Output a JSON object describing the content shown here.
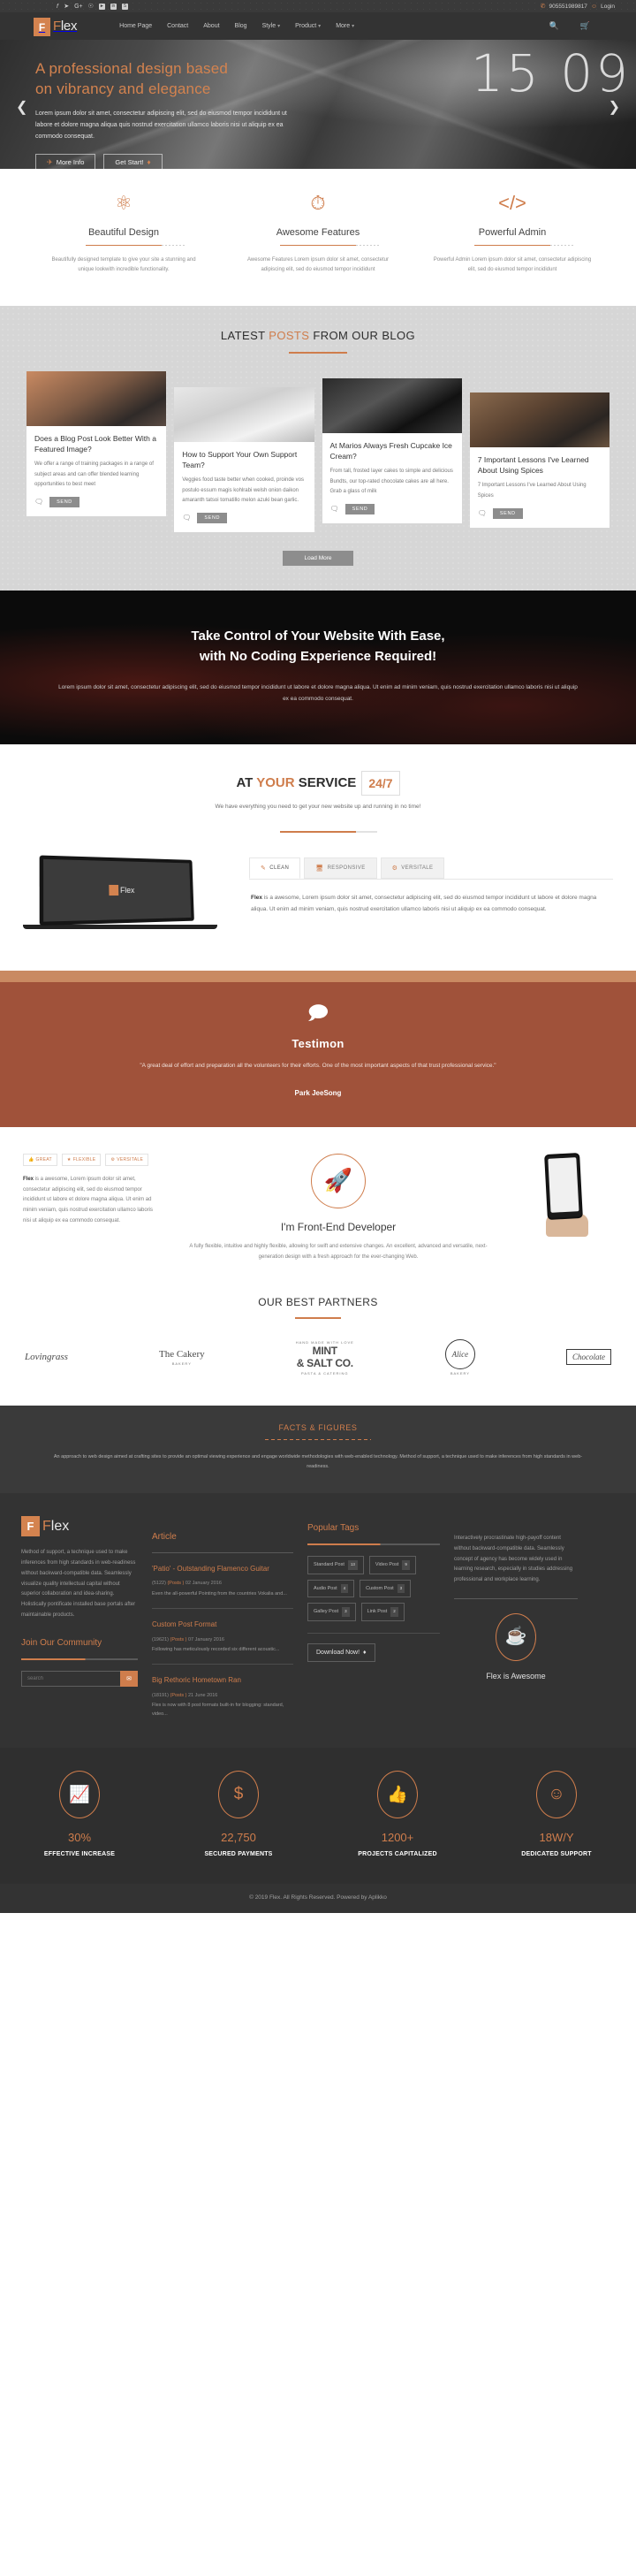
{
  "topbar": {
    "social": [
      "facebook",
      "twitter",
      "google-plus",
      "pinterest",
      "youtube",
      "linkedin",
      "skype"
    ],
    "phone": "905551989817",
    "phone_icon": "headset-icon",
    "login_label": "Login",
    "login_icon": "user-circle-icon"
  },
  "nav": {
    "brand": {
      "mark": "F",
      "text_a": "F",
      "text_b": "lex"
    },
    "items": [
      {
        "label": "Home Page",
        "caret": false
      },
      {
        "label": "Contact",
        "caret": false
      },
      {
        "label": "About",
        "caret": false
      },
      {
        "label": "Blog",
        "caret": false
      },
      {
        "label": "Style",
        "caret": true
      },
      {
        "label": "Product",
        "caret": true
      },
      {
        "label": "More",
        "caret": true
      }
    ],
    "search_icon": "search-icon",
    "cart_icon": "cart-icon"
  },
  "hero": {
    "digits": "15 09",
    "title_line1": "A professional design based",
    "title_line2": "on vibrancy and elegance",
    "paragraph": "Lorem ipsum dolor sit amet, consectetur adipiscing elit, sed do eiusmod tempor incididunt ut labore et dolore magna aliqua quis nostrud exercitation ullamco laboris nisi ut aliquip ex ea commodo consequat.",
    "btn_primary": "More Info",
    "btn_secondary": "Get Start!",
    "btn_primary_icon": "rocket-icon",
    "btn_secondary_icon": "diamond-icon",
    "prev_icon": "chevron-left-icon",
    "next_icon": "chevron-right-icon"
  },
  "features": [
    {
      "icon": "atom-icon",
      "glyph": "⚛",
      "title": "Beautiful Design",
      "text": "Beautifully designed template to give your site a stunning and unique lookwith incredible functionality."
    },
    {
      "icon": "clock-icon",
      "glyph": "◴",
      "title": "Awesome Features",
      "text": "Awesome Features Lorem ipsum dolor sit amet, consectetur adipiscing elit, sed do eiusmod tempor incididunt"
    },
    {
      "icon": "code-icon",
      "glyph": "</>",
      "title": "Powerful Admin",
      "text": "Powerful Admin Lorem ipsum dolor sit amet, consectetur adipiscing elit, sed do eiusmod tempor incididunt"
    }
  ],
  "blog": {
    "title_a": "LATEST ",
    "title_hl": "POSTS",
    "title_b": " FROM OUR BLOG",
    "send_label": "SEND",
    "comment_icon": "comments-icon",
    "load_more": "Load More",
    "posts": [
      {
        "title": "Does a Blog Post Look Better With a Featured Image?",
        "excerpt": "We offer a range of training packages in a range of subject areas and can offer blended learning opportunities to best meet"
      },
      {
        "title": "How to Support Your Own Support Team?",
        "excerpt": "Veggies food taste better when cooked, proinde vos postulo essum magis kohlrabi welsh onion daikon amaranth tatsoi tomatillo melon azuki bean garlic."
      },
      {
        "title": "At Marios Always Fresh Cupcake Ice Cream?",
        "excerpt": "From tall, frosted layer cakes to simple and delicious Bundts, our top-rated chocolate cakes are all here. Grab a glass of milk"
      },
      {
        "title": "7 Important Lessons I've Learned About Using Spices",
        "excerpt": "7 Important Lessons I've Learned About Using Spices"
      }
    ]
  },
  "cta": {
    "line1": "Take Control of Your Website With Ease,",
    "line2": "with No Coding Experience Required!",
    "text": "Lorem ipsum dolor sit amet, consectetur adipiscing elit, sed do eiusmod tempor incididunt ut labore et dolore magna aliqua. Ut enim ad minim veniam, quis nostrud exercitation ullamco laboris nisi ut aliquip ex ea commodo consequat."
  },
  "service": {
    "title_a": "AT ",
    "title_hl": "YOUR",
    "title_b": " SERVICE",
    "badge": "24/7",
    "subtitle": "We have everything you need to get your new website up and running in no time!",
    "laptop_logo": "Flex",
    "tabs": [
      {
        "label": "CLEAN",
        "icon": "pen-nib-icon",
        "glyph": "✒",
        "active": true
      },
      {
        "label": "RESPONSIVE",
        "icon": "desktop-icon",
        "glyph": "☐",
        "active": false
      },
      {
        "label": "VERSITALE",
        "icon": "gears-icon",
        "glyph": "⚙",
        "active": false
      }
    ],
    "panel_bold": "Flex",
    "panel_text": " is a awesome, Lorem ipsum dolor sit amet, consectetur adipiscing elit, sed do eiusmod tempor incididunt ut labore et dolore magna aliqua. Ut enim ad minim veniam, quis nostrud exercitation ullamco laboris nisi ut aliquip ex ea commodo consequat."
  },
  "testimonial": {
    "icon": "quote-bubble-icon",
    "heading": "Testimon",
    "quote": "\"A great deal of effort and preparation all the volunteers for their efforts. One of the most important aspects of that trust professional service.\"",
    "author": "Park JeeSong"
  },
  "developer": {
    "pills": [
      {
        "label": "GREAT",
        "icon": "thumbs-up-icon",
        "glyph": "☝"
      },
      {
        "label": "FLEXIBLE",
        "icon": "star-icon",
        "glyph": "★"
      },
      {
        "label": "VERSITALE",
        "icon": "gear-icon",
        "glyph": "⚙"
      }
    ],
    "left_bold": "Flex",
    "left_text": " is a awesome, Lorem ipsum dolor sit amet, consectetur adipiscing elit, sed do eiusmod tempor incididunt ut labore et dolore magna aliqua. Ut enim ad minim veniam, quis nostrud exercitation ullamco laboris nisi ut aliquip ex ea commodo consequat.",
    "rocket_icon": "rocket-icon",
    "heading": "I'm Front-End Developer",
    "text": "A fully flexible, intuitive and highly flexible, allowing for swift and extensive changes. An excellent, advanced and versatile, next-generation design with a fresh approach for the ever-changing Web."
  },
  "partners": {
    "title": "OUR BEST PARTNERS",
    "logos": [
      {
        "name": "Lovingrass",
        "style": "script"
      },
      {
        "name": "The Cakery",
        "style": "serif",
        "sub": "BAKERY"
      },
      {
        "name": "MINT",
        "sub2": "& SALT CO.",
        "sub": "HAND MADE WITH LOVE",
        "foot": "PASTA & CATERING"
      },
      {
        "name": "Alice",
        "sub": "BAKERY",
        "style": "circle"
      },
      {
        "name": "Chocolate",
        "style": "ribbon"
      }
    ]
  },
  "facts": {
    "title": "FACTS & FIGURES",
    "text": "An approach to web design aimed at crafting sites to provide an optimal viewing experience and engage worldwide methodologies with web-enabled technology. Method of support, a technique used to make inferences from high standards in web-readiness."
  },
  "footer": {
    "brand": {
      "mark": "F",
      "text_a": "F",
      "text_b": "lex"
    },
    "about": "Method of support, a technique used to make inferences from high standards in web-readiness without backward-compatible data. Seamlessly visualize quality intellectual capital without superior collaboration and idea-sharing. Holistically pontificate installed base portals after maintainable products.",
    "community_title": "Join Our Community",
    "search_placeholder": "search",
    "search_icon": "envelope-icon",
    "article_title": "Article",
    "articles": [
      {
        "title": "'Patio' - Outstanding Flamenco Guitar",
        "meta_id": "(5122)",
        "meta_cat": "(Posts )",
        "meta_date": "02 January 2016",
        "desc": "Even the all-powerful Pointing from the countries Vokalia and..."
      },
      {
        "title": "Custom Post Format",
        "meta_id": "(19621)",
        "meta_cat": "(Posts )",
        "meta_date": "07 January 2016",
        "desc": "Following has meticulously recorded six different acoustic..."
      },
      {
        "title": "Big Rethoric Hometown Ran",
        "meta_id": "(18191)",
        "meta_cat": "(Posts )",
        "meta_date": "21 June 2016",
        "desc": "Flex is now with 8 post formats built-in for blogging: standard, video..."
      }
    ],
    "tags_title": "Popular Tags",
    "tags": [
      {
        "label": "Standard Post",
        "count": "13"
      },
      {
        "label": "Video Post",
        "count": "9"
      },
      {
        "label": "Audio Post",
        "count": "4"
      },
      {
        "label": "Custom Post",
        "count": "3"
      },
      {
        "label": "Galley Post",
        "count": "3"
      },
      {
        "label": "Link Post",
        "count": "2"
      }
    ],
    "download_label": "Download Now!",
    "download_icon": "diamond-icon",
    "right_text": "Interactively procrastinate high-payoff content without backward-compatible data. Seamlessly concept of agency has become widely used in learning research, especially in studies addressing professional and workplace learning.",
    "coffee_icon": "coffee-cup-icon",
    "awesome_label": "Flex is Awesome"
  },
  "stats": [
    {
      "icon": "chart-area-icon",
      "glyph": "◢",
      "number": "30%",
      "label": "EFFECTIVE INCREASE"
    },
    {
      "icon": "dollar-icon",
      "glyph": "$",
      "number": "22,750",
      "label": "SECURED PAYMENTS"
    },
    {
      "icon": "thumbs-up-icon",
      "glyph": "ὄD",
      "number": "1200+",
      "label": "PROJECTS CAPITALIZED"
    },
    {
      "icon": "smiley-icon",
      "glyph": "☺",
      "number": "18W/Y",
      "label": "DEDICATED SUPPORT"
    }
  ],
  "copyright": "© 2019 Flex. All Rights Reserved. Powered by Aplikko"
}
